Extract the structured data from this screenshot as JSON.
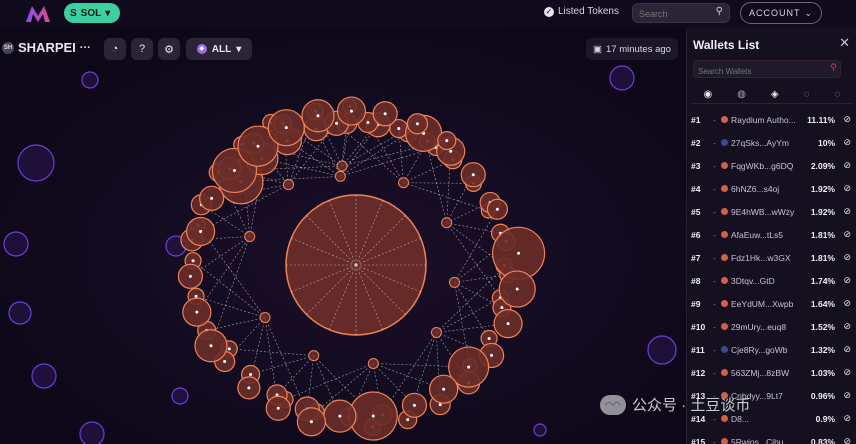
{
  "header": {
    "chain_label": "SOL",
    "chain_icon": "S",
    "listed_tokens_label": "Listed Tokens",
    "search_placeholder": "Search",
    "account_label": "ACCOUNT"
  },
  "toolbar": {
    "token_name": "SHARPEI",
    "token_icon": "SH",
    "more_label": "···",
    "filter_label": "ALL",
    "time_label": "17 minutes ago"
  },
  "wallets_panel": {
    "title": "Wallets List",
    "search_placeholder": "Search Wallets",
    "rows": [
      {
        "rank": "#1",
        "address": "Raydium Autho...",
        "percent": "11.11%",
        "color": "#d06048"
      },
      {
        "rank": "#2",
        "address": "27qSks...AyYm",
        "percent": "10%",
        "color": "#3a4a90"
      },
      {
        "rank": "#3",
        "address": "FqgWKb...g6DQ",
        "percent": "2.09%",
        "color": "#d06048"
      },
      {
        "rank": "#4",
        "address": "6hNZ6...s4oj",
        "percent": "1.92%",
        "color": "#d06048"
      },
      {
        "rank": "#5",
        "address": "9E4hWB...wWzy",
        "percent": "1.92%",
        "color": "#d06048"
      },
      {
        "rank": "#6",
        "address": "AfaEuw...tLs5",
        "percent": "1.81%",
        "color": "#d06048"
      },
      {
        "rank": "#7",
        "address": "Fdz1Hk...w3GX",
        "percent": "1.81%",
        "color": "#d06048"
      },
      {
        "rank": "#8",
        "address": "3Dtqv...GtD",
        "percent": "1.74%",
        "color": "#d06048"
      },
      {
        "rank": "#9",
        "address": "EeYdUM...Xwpb",
        "percent": "1.64%",
        "color": "#d06048"
      },
      {
        "rank": "#10",
        "address": "29mUry...euq8",
        "percent": "1.52%",
        "color": "#d06048"
      },
      {
        "rank": "#11",
        "address": "Cje8Ry...goWb",
        "percent": "1.32%",
        "color": "#3a4a90"
      },
      {
        "rank": "#12",
        "address": "563ZMj...8zBW",
        "percent": "1.03%",
        "color": "#d06048"
      },
      {
        "rank": "#13",
        "address": "Cnbdyy...9Lt7",
        "percent": "0.96%",
        "color": "#d06048"
      },
      {
        "rank": "#14",
        "address": "D8...",
        "percent": "0.9%",
        "color": "#d06048"
      },
      {
        "rank": "#15",
        "address": "5Rwjos...Cjbu",
        "percent": "0.83%",
        "color": "#d06048"
      }
    ]
  },
  "watermark": {
    "text": "公众号 · 土豆谈币"
  },
  "colors": {
    "bubble_fill": "#6a2c28",
    "bubble_stroke": "#f0825a",
    "accent_purple": "#6c3fd8",
    "chain_green": "#3ecfa0"
  }
}
